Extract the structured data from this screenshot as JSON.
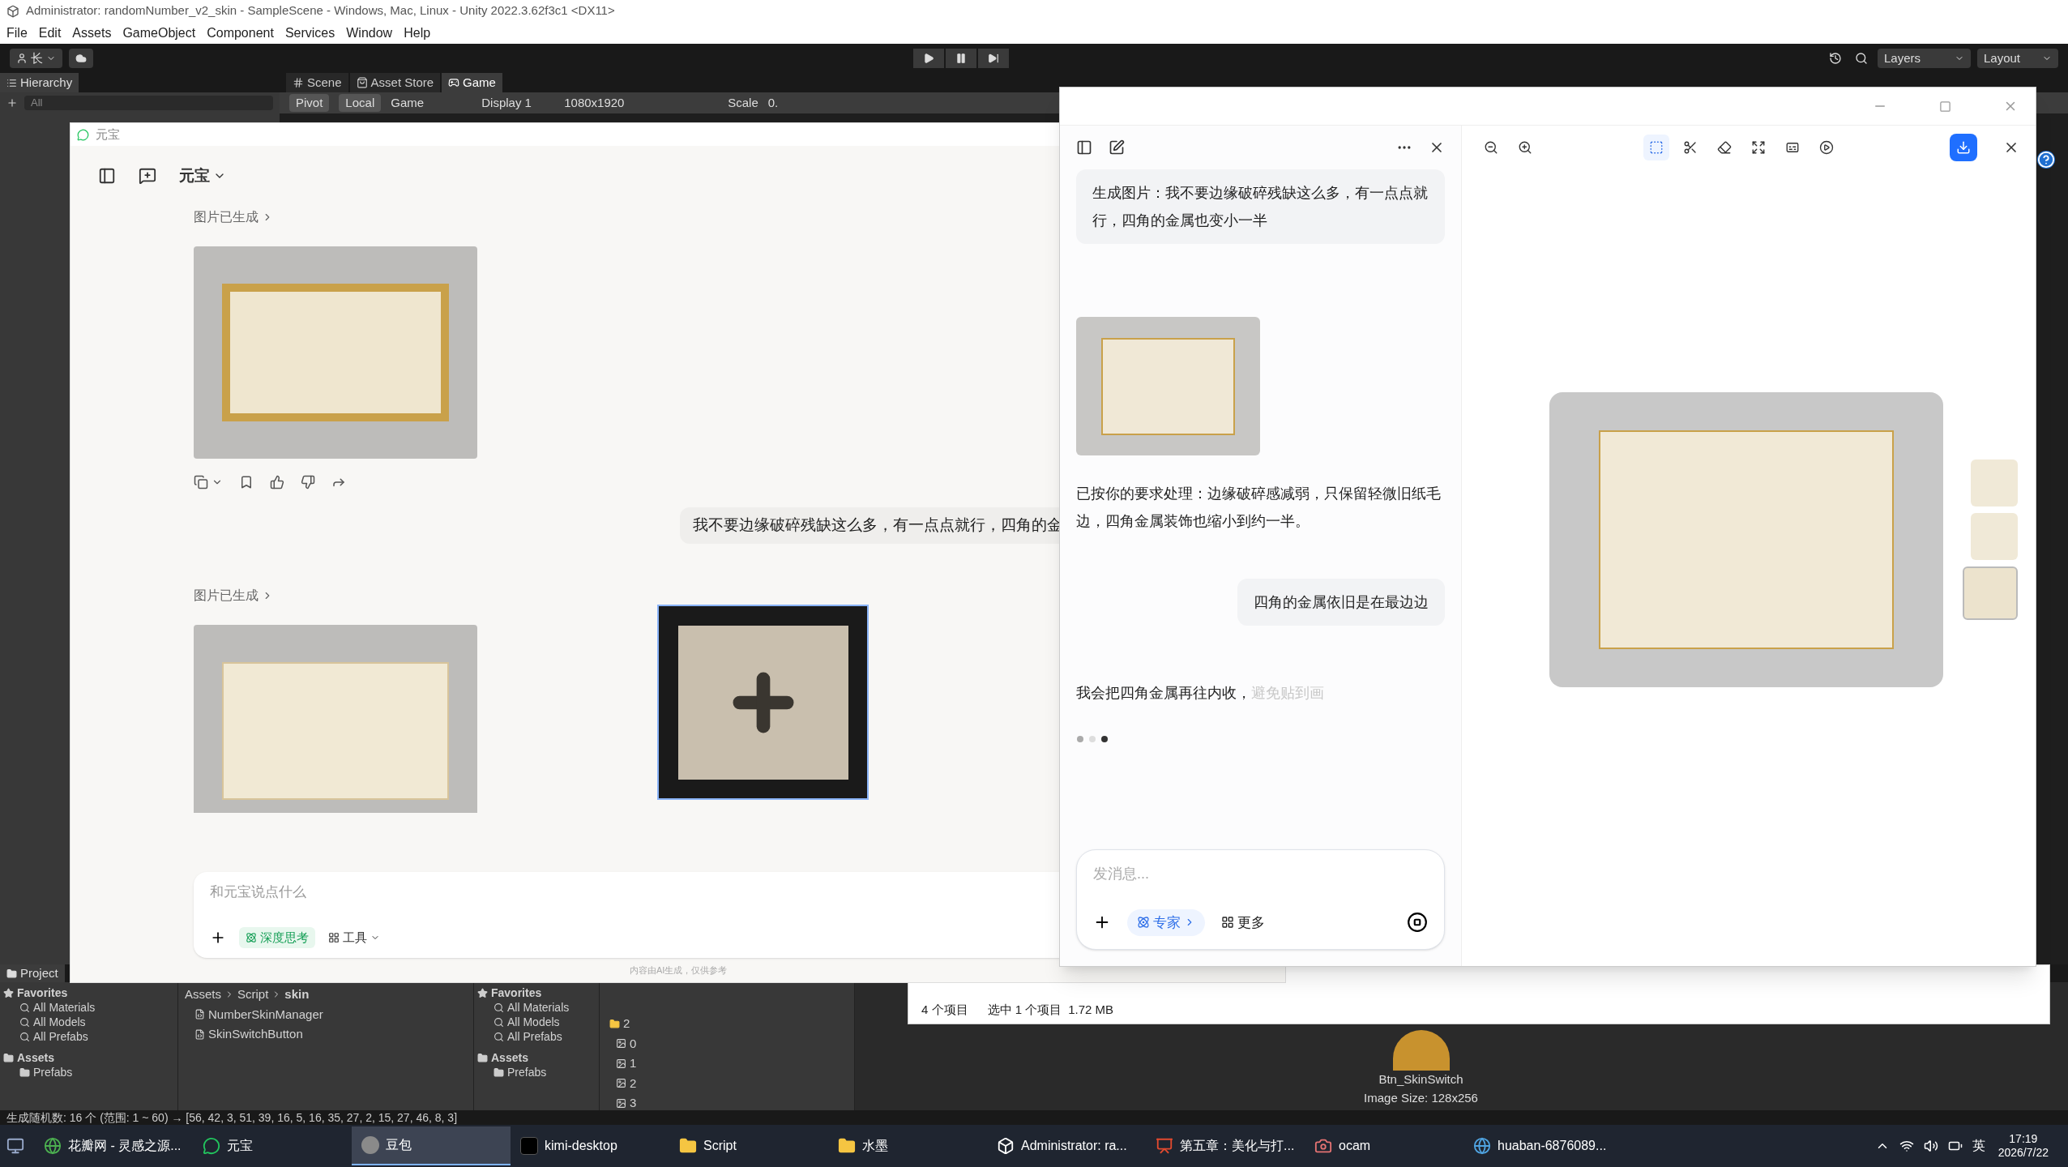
{
  "unity": {
    "title": "Administrator: randomNumber_v2_skin - SampleScene - Windows, Mac, Linux - Unity 2022.3.62f3c1 <DX11>",
    "menu": [
      "File",
      "Edit",
      "Assets",
      "GameObject",
      "Component",
      "Services",
      "Window",
      "Help"
    ],
    "account": "长",
    "layers": "Layers",
    "layout": "Layout",
    "hierarchy": {
      "tab": "Hierarchy",
      "placeholder": "All"
    },
    "scene_tabs": [
      {
        "label": "Scene",
        "kind": "scene",
        "selected": false
      },
      {
        "label": "Asset Store",
        "kind": "store",
        "selected": false
      },
      {
        "label": "Game",
        "kind": "game",
        "selected": true
      }
    ],
    "game_toolbar": {
      "pivot": "Pivot",
      "local": "Local",
      "view": "Game",
      "display": "Display 1",
      "resolution": "1080x1920",
      "scale": "Scale",
      "scale_value": "0."
    },
    "project": {
      "tab": "Project",
      "trees": [
        {
          "favorites_label": "Favorites",
          "favorites": [
            "All Materials",
            "All Models",
            "All Prefabs"
          ],
          "assets_label": "Assets",
          "assets": [
            "Prefabs"
          ]
        },
        {
          "favorites_label": "Favorites",
          "favorites": [
            "All Materials",
            "All Models",
            "All Prefabs"
          ],
          "assets_label": "Assets",
          "assets": [
            "Prefabs"
          ]
        }
      ],
      "breadcrumb": [
        "Assets",
        "Script",
        "skin"
      ],
      "files": [
        "NumberSkinManager",
        "SkinSwitchButton"
      ],
      "folder": "2",
      "sprites": [
        "0",
        "1",
        "2",
        "3"
      ],
      "preview_name": "Btn_SkinSwitch",
      "preview_size": "Image Size: 128x256"
    },
    "status": "生成随机数: 16 个 (范围: 1 ~ 60) → [56, 42, 3, 51, 39, 16, 5, 16, 35, 27, 2, 15, 27, 46, 8, 3]"
  },
  "explorer": {
    "count": "4 个项目",
    "selection": "选中 1 个项目",
    "size": "1.72 MB"
  },
  "yuanbao": {
    "title": "元宝",
    "model": "元宝",
    "results": [
      {
        "label": "图片已生成"
      },
      {
        "label": "图片已生成"
      }
    ],
    "user_message": "我不要边缘破碎残缺这么多，有一点点就行，四角的金",
    "input": {
      "placeholder": "和元宝说点什么",
      "deep_think": {
        "label": "深度思考",
        "on": true
      },
      "tools": "工具"
    },
    "footer": "内容由AI生成，仅供参考"
  },
  "doubao": {
    "messages": [
      {
        "kind": "user",
        "text": "生成图片：我不要边缘破碎残缺这么多，有一点点就行，四角的金属也变小一半"
      },
      {
        "kind": "image"
      },
      {
        "kind": "bot",
        "text": "已按你的要求处理：边缘破碎感减弱，只保留轻微旧纸毛边，四角金属装饰也缩小到约一半。"
      },
      {
        "kind": "user",
        "text": "四角的金属依旧是在最边边"
      },
      {
        "kind": "streaming",
        "text": "我会把四角金属再往内收，",
        "tail": "避免贴到画"
      }
    ],
    "input": {
      "placeholder": "发消息...",
      "expert": {
        "label": "专家",
        "selected": true
      },
      "more": "更多"
    },
    "tools": [
      {
        "kind": "zoom-out",
        "selected": false
      },
      {
        "kind": "zoom-in",
        "selected": false
      },
      {
        "kind": "select",
        "selected": true
      },
      {
        "kind": "cutout",
        "selected": false
      },
      {
        "kind": "eraser",
        "selected": false
      },
      {
        "kind": "expand",
        "selected": false
      },
      {
        "kind": "hd",
        "selected": false
      },
      {
        "kind": "video",
        "selected": false
      }
    ],
    "thumbnails": [
      {
        "selected": false
      },
      {
        "selected": false
      },
      {
        "selected": true
      }
    ]
  },
  "taskbar": {
    "items": [
      {
        "label": "花瓣网 - 灵感之源...",
        "kind": "browser",
        "selected": false
      },
      {
        "label": "元宝",
        "kind": "chat",
        "selected": false
      },
      {
        "label": "豆包",
        "kind": "avatar",
        "selected": true
      },
      {
        "label": "kimi-desktop",
        "kind": "k",
        "selected": false
      },
      {
        "label": "Script",
        "kind": "folder",
        "selected": false
      },
      {
        "label": "水墨",
        "kind": "folder",
        "selected": false
      },
      {
        "label": "Administrator: ra...",
        "kind": "unity",
        "selected": false
      },
      {
        "label": "第五章：美化与打...",
        "kind": "slides",
        "selected": false
      },
      {
        "label": "ocam",
        "kind": "camera",
        "selected": false
      },
      {
        "label": "huaban-6876089...",
        "kind": "web",
        "selected": false
      }
    ],
    "lang": "英",
    "time": "17:19",
    "date": "2026/7/22"
  }
}
